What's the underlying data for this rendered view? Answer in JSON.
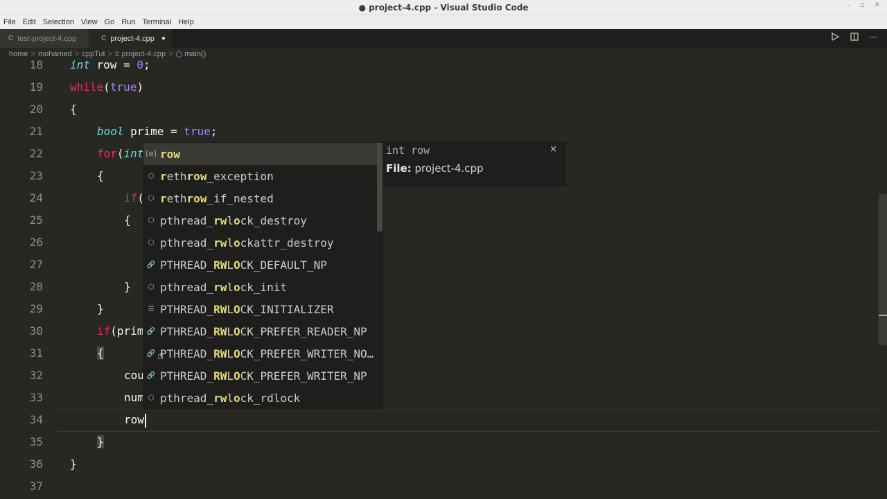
{
  "window": {
    "title": "● project-4.cpp - Visual Studio Code",
    "controls": [
      "–",
      "▫",
      "✕"
    ]
  },
  "menu": [
    "File",
    "Edit",
    "Selection",
    "View",
    "Go",
    "Run",
    "Terminal",
    "Help"
  ],
  "tabs": [
    {
      "label": "test-project-4.cpp",
      "icon": "C"
    },
    {
      "label": "project-4.cpp",
      "icon": "C",
      "modified": "●"
    }
  ],
  "breadcrumb": {
    "items": [
      "home",
      "mohamed",
      "cppTut",
      "project-4.cpp",
      "main()"
    ],
    "separator": ">"
  },
  "gutter": [
    "18",
    "19",
    "20",
    "21",
    "22",
    "23",
    "24",
    "25",
    "26",
    "27",
    "28",
    "29",
    "30",
    "31",
    "32",
    "33",
    "34",
    "35",
    "36",
    "37"
  ],
  "code_text": {
    "l18": "int row = 0;",
    "l19": "while(true)",
    "l20": "{",
    "l21": "bool prime = true;",
    "l22": "for(int",
    "l23": "{",
    "l24": "if(",
    "l25": "{",
    "l28": "}",
    "l29": "}",
    "l30": "if(prim",
    "l31": "{",
    "l32": "cou",
    "l33": "num",
    "l34": "row",
    "l35": "}",
    "l36": "}"
  },
  "suggest": {
    "items": [
      {
        "icon": "[⊡]",
        "pre": "",
        "match": "row",
        "post": ""
      },
      {
        "icon": "⬡",
        "pre": "",
        "match": "r",
        "mid": "eth",
        "match2": "row",
        "post": "_exception"
      },
      {
        "icon": "⬡",
        "pre": "",
        "match": "r",
        "mid": "eth",
        "match2": "row",
        "post": "_if_nested"
      },
      {
        "icon": "⬡",
        "pre": "pthread_",
        "match": "rw",
        "mid": "l",
        "match2": "o",
        "post": "ck_destroy"
      },
      {
        "icon": "⬡",
        "pre": "pthread_",
        "match": "rw",
        "mid": "l",
        "match2": "o",
        "post": "ckattr_destroy"
      },
      {
        "icon": "🔗",
        "pre": "PTHREAD_",
        "match": "RW",
        "mid": "L",
        "match2": "O",
        "post": "CK_DEFAULT_NP"
      },
      {
        "icon": "⬡",
        "pre": "pthread_",
        "match": "rw",
        "mid": "l",
        "match2": "o",
        "post": "ck_init"
      },
      {
        "icon": "☰",
        "pre": "PTHREAD_",
        "match": "RW",
        "mid": "L",
        "match2": "O",
        "post": "CK_INITIALIZER"
      },
      {
        "icon": "🔗",
        "pre": "PTHREAD_",
        "match": "RW",
        "mid": "L",
        "match2": "O",
        "post": "CK_PREFER_READER_NP"
      },
      {
        "icon": "🔗",
        "pre": "PTHREAD_",
        "match": "RW",
        "mid": "L",
        "match2": "O",
        "post": "CK_PREFER_WRITER_NO…"
      },
      {
        "icon": "🔗",
        "pre": "PTHREAD_",
        "match": "RW",
        "mid": "L",
        "match2": "O",
        "post": "CK_PREFER_WRITER_NP"
      },
      {
        "icon": "⬡",
        "pre": "pthread_",
        "match": "rw",
        "mid": "l",
        "match2": "o",
        "post": "ck_rdlock"
      }
    ]
  },
  "details": {
    "signature": "int row",
    "file_label": "File:",
    "file_value": "project-4.cpp",
    "close": "×"
  },
  "colors": {
    "keyword": "#f92672",
    "type": "#66d9ef",
    "number": "#ae81ff",
    "match": "#e6db74",
    "bg": "#272822"
  }
}
